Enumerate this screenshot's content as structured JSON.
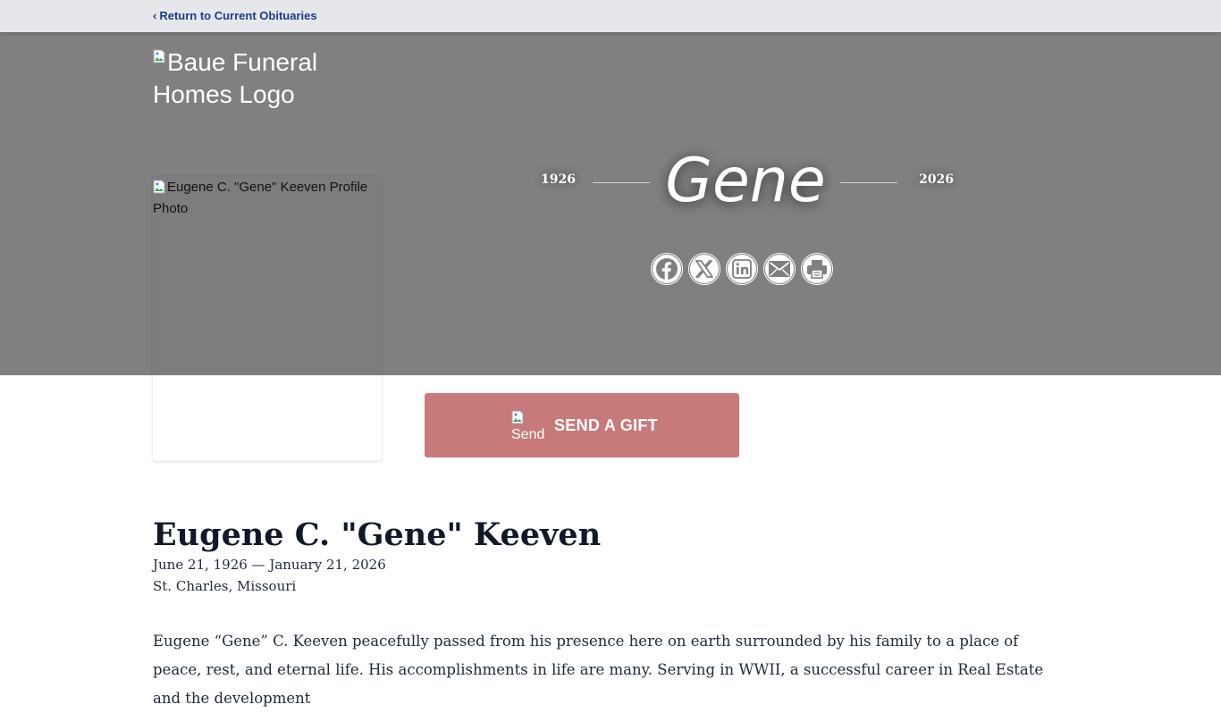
{
  "topbar": {
    "back_label": "Return to Current Obituaries",
    "back_icon": "chevron-left-icon"
  },
  "header": {
    "logo_alt": "Baue Funeral Homes Logo",
    "profile_photo_alt": "Eugene C. \"Gene\" Keeven Profile Photo",
    "birth_year": "1926",
    "death_year": "2026",
    "display_name": "Gene",
    "share_buttons": [
      {
        "icon": "facebook-icon"
      },
      {
        "icon": "x-icon"
      },
      {
        "icon": "linkedin-icon"
      },
      {
        "icon": "email-icon"
      },
      {
        "icon": "print-icon"
      }
    ]
  },
  "gift": {
    "label": "SEND A GIFT",
    "image_alt": "Send"
  },
  "obituary": {
    "full_name": "Eugene C. \"Gene\" Keeven",
    "dates": "June 21, 1926 — January 21, 2026",
    "location": "St. Charles, Missouri",
    "text": "Eugene “Gene” C. Keeven peacefully passed from his presence here on earth surrounded by his family to a place of peace, rest, and eternal life. His accomplishments in life are many. Serving in WWII, a successful career in Real Estate and the development"
  },
  "colors": {
    "topbar_bg": "#e5e7eb",
    "link": "#1e3a8a",
    "hero_bg": "#808080",
    "gift_button": "#c87a7a",
    "text": "#111827"
  }
}
